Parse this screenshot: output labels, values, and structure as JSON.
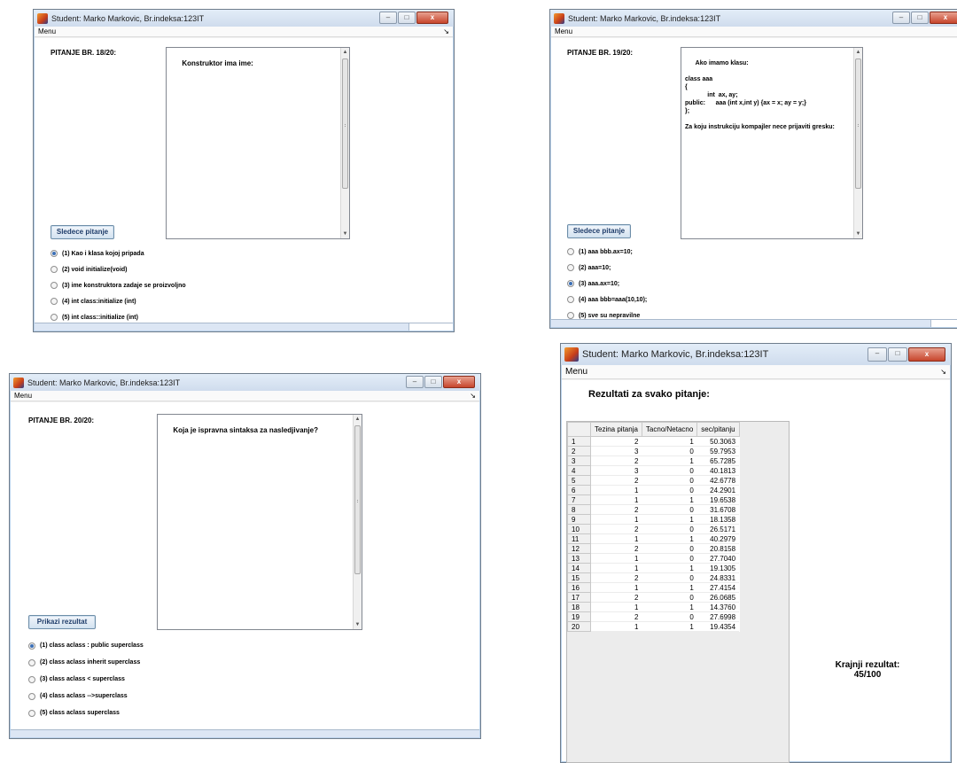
{
  "windows": {
    "q18": {
      "title": "Student: Marko Markovic, Br.indeksa:123IT",
      "menu": "Menu",
      "question_number": "PITANJE BR. 18/20:",
      "question_text": "Konstruktor ima ime:",
      "next_button": "Sledece pitanje",
      "options": [
        {
          "label": "(1) Kao i klasa kojoj pripada",
          "selected": true
        },
        {
          "label": "(2) void initialize(void)",
          "selected": false
        },
        {
          "label": "(3) ime konstruktora zadaje se proizvoljno",
          "selected": false
        },
        {
          "label": "(4) int class:initialize (int)",
          "selected": false
        },
        {
          "label": "(5) int class::initialize (int)",
          "selected": false
        }
      ]
    },
    "q19": {
      "title": "Student: Marko Markovic, Br.indeksa:123IT",
      "menu": "Menu",
      "question_number": "PITANJE BR. 19/20:",
      "question_text": "Ako imamo klasu:\n\nclass aaa\n{\n             int  ax, ay;\npublic:      aaa (int x,int y) {ax = x; ay = y;}\n};\n\nZa koju instrukciju kompajler nece prijaviti gresku:",
      "next_button": "Sledece pitanje",
      "options": [
        {
          "label": "(1) aaa bbb.ax=10;",
          "selected": false
        },
        {
          "label": "(2) aaa=10;",
          "selected": false
        },
        {
          "label": "(3) aaa.ax=10;",
          "selected": true
        },
        {
          "label": "(4) aaa bbb=aaa(10,10);",
          "selected": false
        },
        {
          "label": "(5) sve su nepravilne",
          "selected": false
        }
      ]
    },
    "q20": {
      "title": "Student: Marko Markovic, Br.indeksa:123IT",
      "menu": "Menu",
      "question_number": "PITANJE BR. 20/20:",
      "question_text": "Koja je ispravna sintaksa za nasledjivanje?",
      "result_button": "Prikazi rezultat",
      "options": [
        {
          "label": "(1) class aclass : public superclass",
          "selected": true
        },
        {
          "label": "(2) class aclass inherit superclass",
          "selected": false
        },
        {
          "label": "(3) class aclass < superclass",
          "selected": false
        },
        {
          "label": "(4) class aclass -->superclass",
          "selected": false
        },
        {
          "label": "(5) class aclass superclass",
          "selected": false
        }
      ]
    },
    "results": {
      "title": "Student: Marko Markovic, Br.indeksa:123IT",
      "menu": "Menu",
      "heading": "Rezultati za svako pitanje:",
      "columns": [
        "Tezina pitanja",
        "Tacno/Netacno",
        "sec/pitanju"
      ],
      "rows": [
        [
          "1",
          "2",
          "1",
          "50.3063"
        ],
        [
          "2",
          "3",
          "0",
          "59.7953"
        ],
        [
          "3",
          "2",
          "1",
          "65.7285"
        ],
        [
          "4",
          "3",
          "0",
          "40.1813"
        ],
        [
          "5",
          "2",
          "0",
          "42.6778"
        ],
        [
          "6",
          "1",
          "0",
          "24.2901"
        ],
        [
          "7",
          "1",
          "1",
          "19.6538"
        ],
        [
          "8",
          "2",
          "0",
          "31.6708"
        ],
        [
          "9",
          "1",
          "1",
          "18.1358"
        ],
        [
          "10",
          "2",
          "0",
          "26.5171"
        ],
        [
          "11",
          "1",
          "1",
          "40.2979"
        ],
        [
          "12",
          "2",
          "0",
          "20.8158"
        ],
        [
          "13",
          "1",
          "0",
          "27.7040"
        ],
        [
          "14",
          "1",
          "1",
          "19.1305"
        ],
        [
          "15",
          "2",
          "0",
          "24.8331"
        ],
        [
          "16",
          "1",
          "1",
          "27.4154"
        ],
        [
          "17",
          "2",
          "0",
          "26.0685"
        ],
        [
          "18",
          "1",
          "1",
          "14.3760"
        ],
        [
          "19",
          "2",
          "0",
          "27.6998"
        ],
        [
          "20",
          "1",
          "1",
          "19.4354"
        ]
      ],
      "final_label": "Krajnji rezultat:",
      "final_value": "45/100"
    }
  }
}
